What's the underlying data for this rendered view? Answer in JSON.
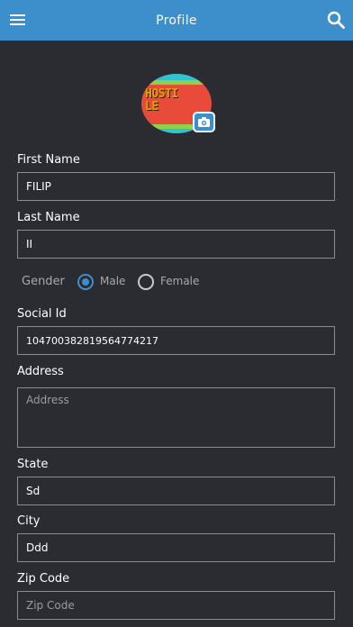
{
  "header": {
    "title": "Profile",
    "menu_icon": "menu-icon",
    "search_icon": "search-icon",
    "background": "#3d8fcc"
  },
  "avatar": {
    "image_text_line1": "HOSTI",
    "image_text_line2": "LE",
    "camera_icon": "camera-icon"
  },
  "form": {
    "first_name": {
      "label": "First Name",
      "value": "FILIP"
    },
    "last_name": {
      "label": "Last Name",
      "value": "II"
    },
    "gender": {
      "label": "Gender",
      "options": [
        {
          "label": "Male",
          "selected": true
        },
        {
          "label": "Female",
          "selected": false
        }
      ]
    },
    "social_id": {
      "label": "Social Id",
      "value": "104700382819564774217"
    },
    "address": {
      "label": "Address",
      "value": "",
      "placeholder": "Address"
    },
    "state": {
      "label": "State",
      "value": "Sd"
    },
    "city": {
      "label": "City",
      "value": "Ddd"
    },
    "zip_code": {
      "label": "Zip Code",
      "value": "",
      "placeholder": "Zip Code"
    }
  },
  "colors": {
    "background": "#2b2c32",
    "accent": "#3d8fcc",
    "field_border": "#8a8b8f"
  }
}
